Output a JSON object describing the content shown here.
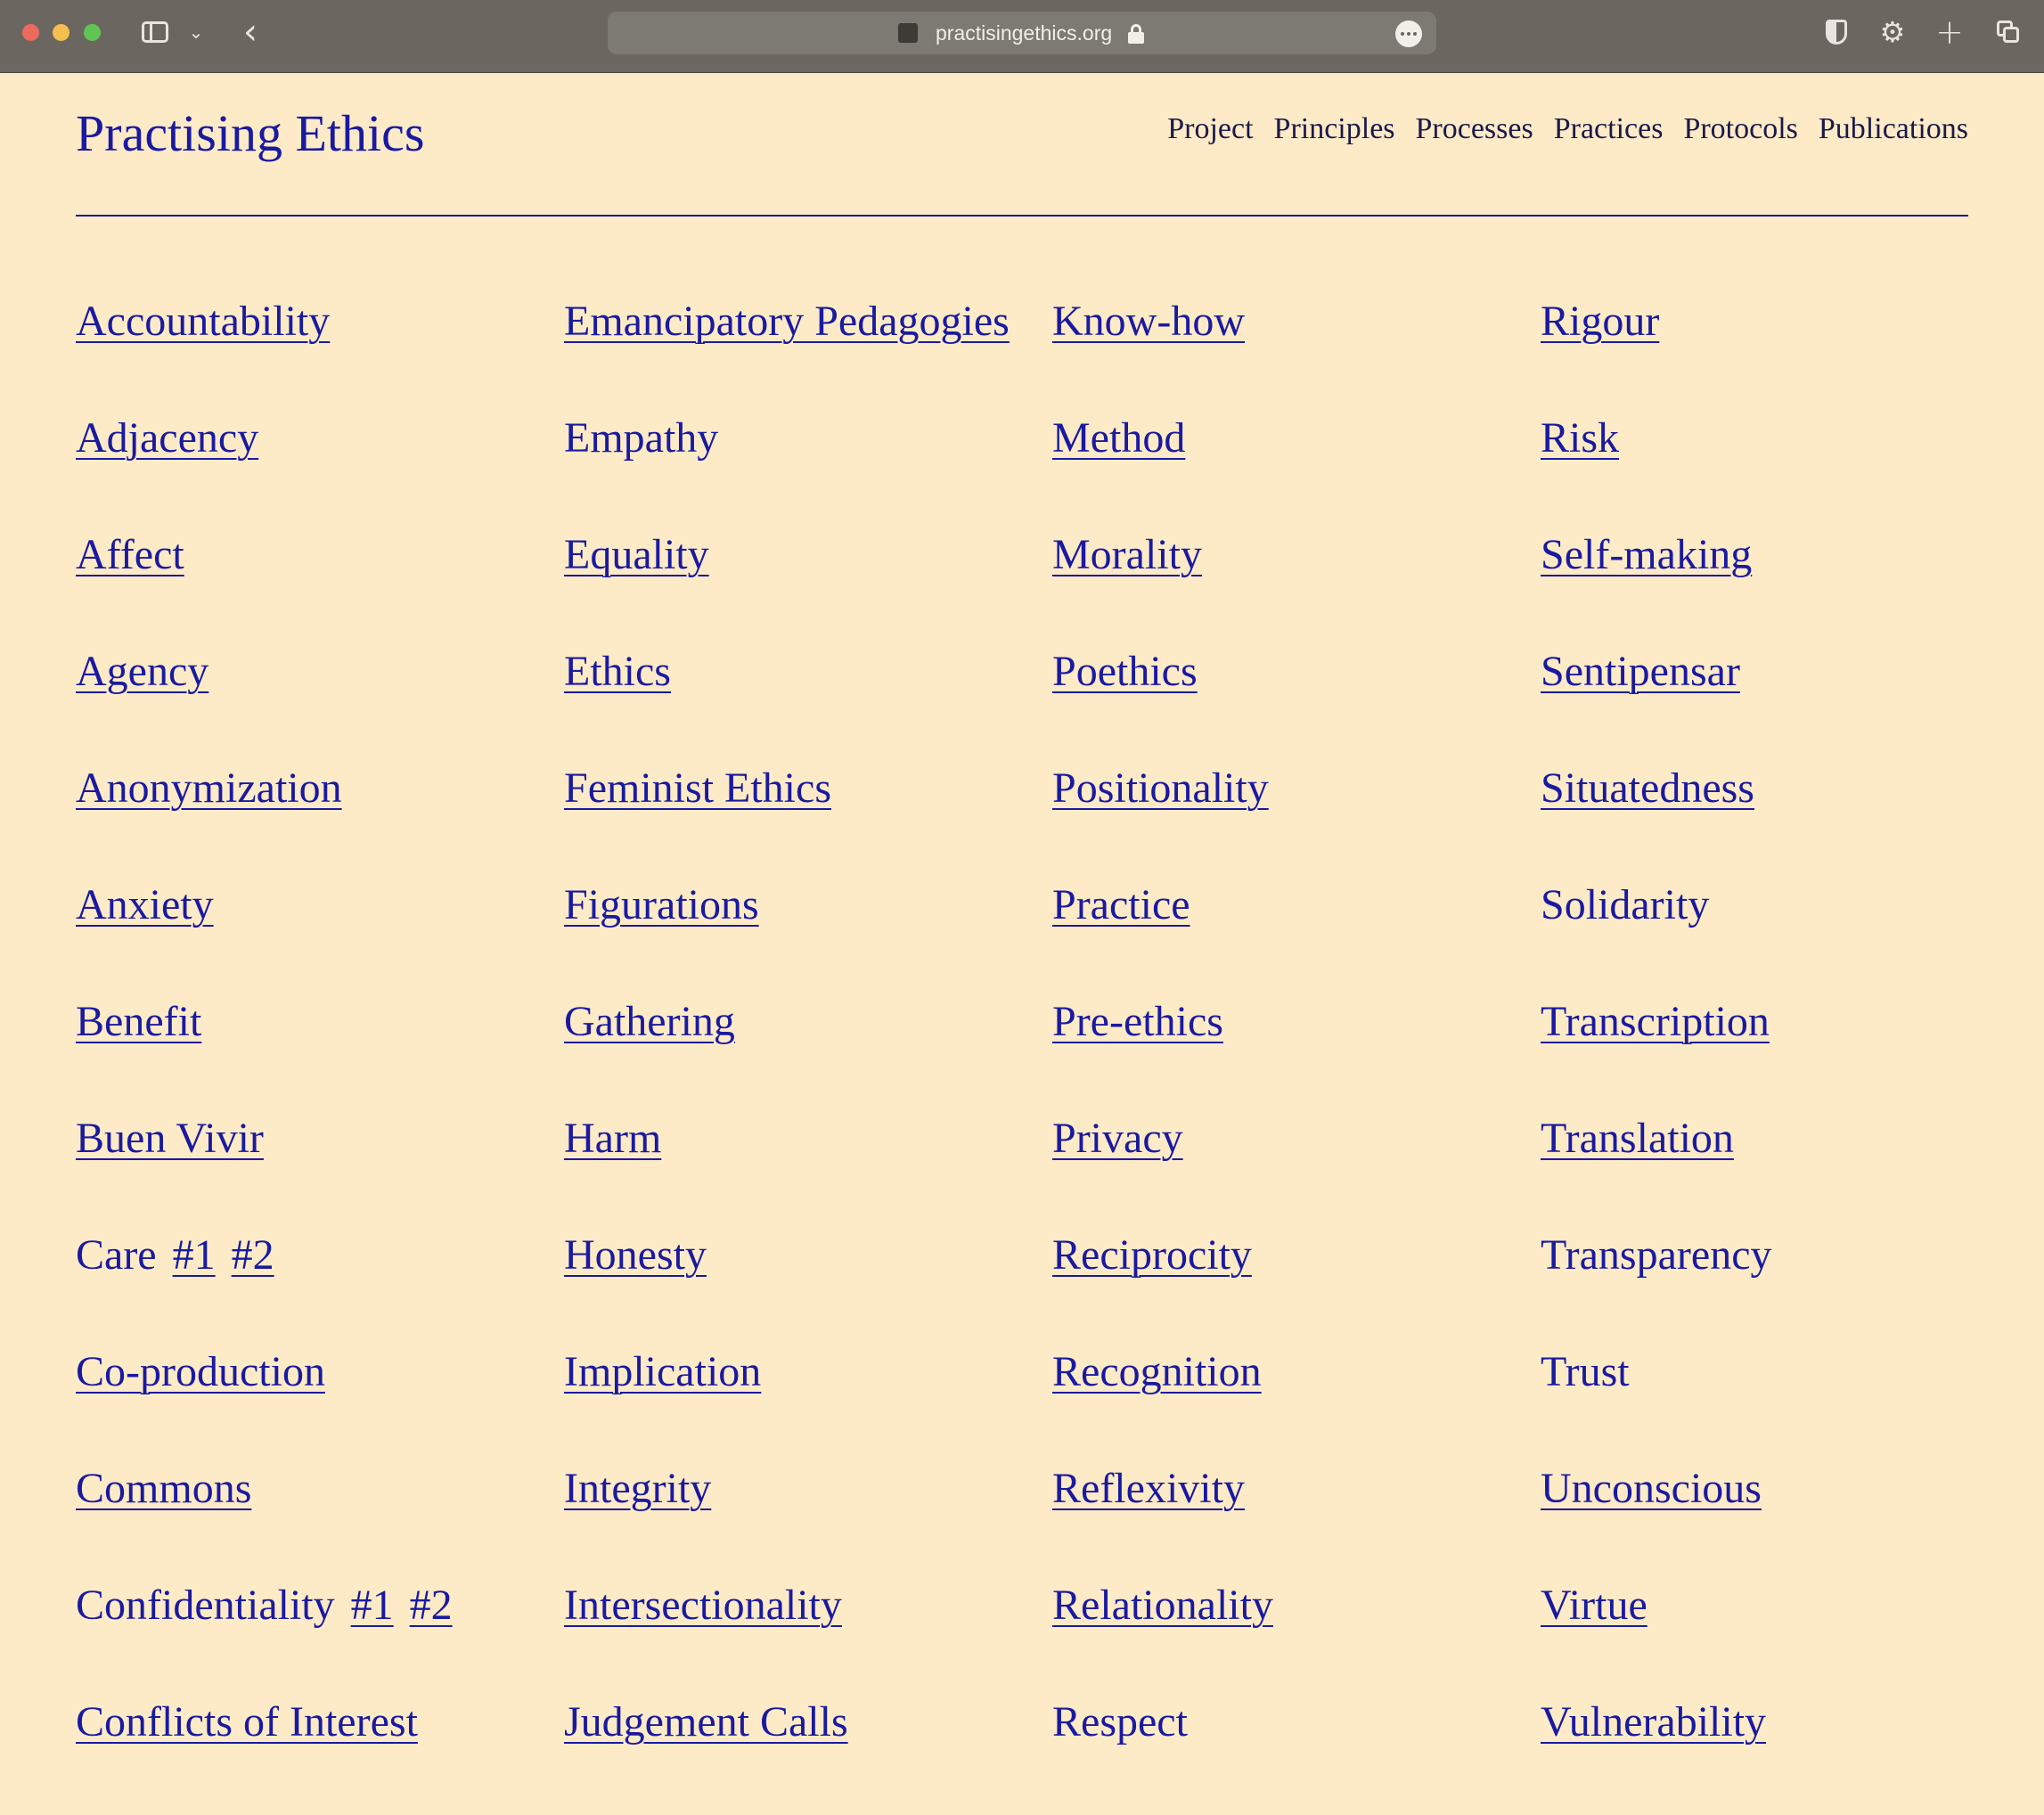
{
  "browser": {
    "url": "practisingethics.org"
  },
  "site": {
    "title": "Practising Ethics",
    "nav": [
      "Project",
      "Principles",
      "Processes",
      "Practices",
      "Protocols",
      "Publications"
    ]
  },
  "columns": [
    [
      {
        "label": "Accountability",
        "link": true
      },
      {
        "label": "Adjacency",
        "link": true
      },
      {
        "label": "Affect",
        "link": true
      },
      {
        "label": "Agency",
        "link": true
      },
      {
        "label": "Anonymization",
        "link": true
      },
      {
        "label": "Anxiety",
        "link": true
      },
      {
        "label": "Benefit",
        "link": true
      },
      {
        "label": "Buen Vivir",
        "link": true
      },
      {
        "label": "Care",
        "link": false,
        "subs": [
          "#1",
          "#2"
        ]
      },
      {
        "label": "Co-production",
        "link": true
      },
      {
        "label": "Commons",
        "link": true
      },
      {
        "label": "Confidentiality",
        "link": false,
        "subs": [
          "#1",
          "#2"
        ]
      },
      {
        "label": "Conflicts of Interest",
        "link": true
      }
    ],
    [
      {
        "label": "Emancipatory Pedagogies",
        "link": true
      },
      {
        "label": "Empathy",
        "link": false
      },
      {
        "label": "Equality",
        "link": true
      },
      {
        "label": "Ethics",
        "link": true
      },
      {
        "label": "Feminist Ethics",
        "link": true
      },
      {
        "label": "Figurations",
        "link": true
      },
      {
        "label": "Gathering",
        "link": true
      },
      {
        "label": "Harm",
        "link": true
      },
      {
        "label": "Honesty",
        "link": true
      },
      {
        "label": "Implication",
        "link": true
      },
      {
        "label": "Integrity",
        "link": true
      },
      {
        "label": "Intersectionality",
        "link": true
      },
      {
        "label": "Judgement Calls",
        "link": true
      }
    ],
    [
      {
        "label": "Know-how",
        "link": true
      },
      {
        "label": "Method",
        "link": true
      },
      {
        "label": "Morality",
        "link": true
      },
      {
        "label": "Poethics",
        "link": true
      },
      {
        "label": "Positionality",
        "link": true
      },
      {
        "label": "Practice",
        "link": true
      },
      {
        "label": "Pre-ethics",
        "link": true
      },
      {
        "label": "Privacy",
        "link": true
      },
      {
        "label": "Reciprocity",
        "link": true
      },
      {
        "label": "Recognition",
        "link": true
      },
      {
        "label": "Reflexivity",
        "link": true
      },
      {
        "label": "Relationality",
        "link": true
      },
      {
        "label": "Respect",
        "link": false
      }
    ],
    [
      {
        "label": "Rigour",
        "link": true
      },
      {
        "label": "Risk",
        "link": true
      },
      {
        "label": "Self-making",
        "link": true
      },
      {
        "label": "Sentipensar",
        "link": true
      },
      {
        "label": "Situatedness",
        "link": true
      },
      {
        "label": "Solidarity",
        "link": false
      },
      {
        "label": "Transcription",
        "link": true
      },
      {
        "label": "Translation",
        "link": true
      },
      {
        "label": "Transparency",
        "link": false
      },
      {
        "label": "Trust",
        "link": false
      },
      {
        "label": "Unconscious",
        "link": true
      },
      {
        "label": "Virtue",
        "link": true
      },
      {
        "label": "Vulnerability",
        "link": true
      }
    ]
  ]
}
